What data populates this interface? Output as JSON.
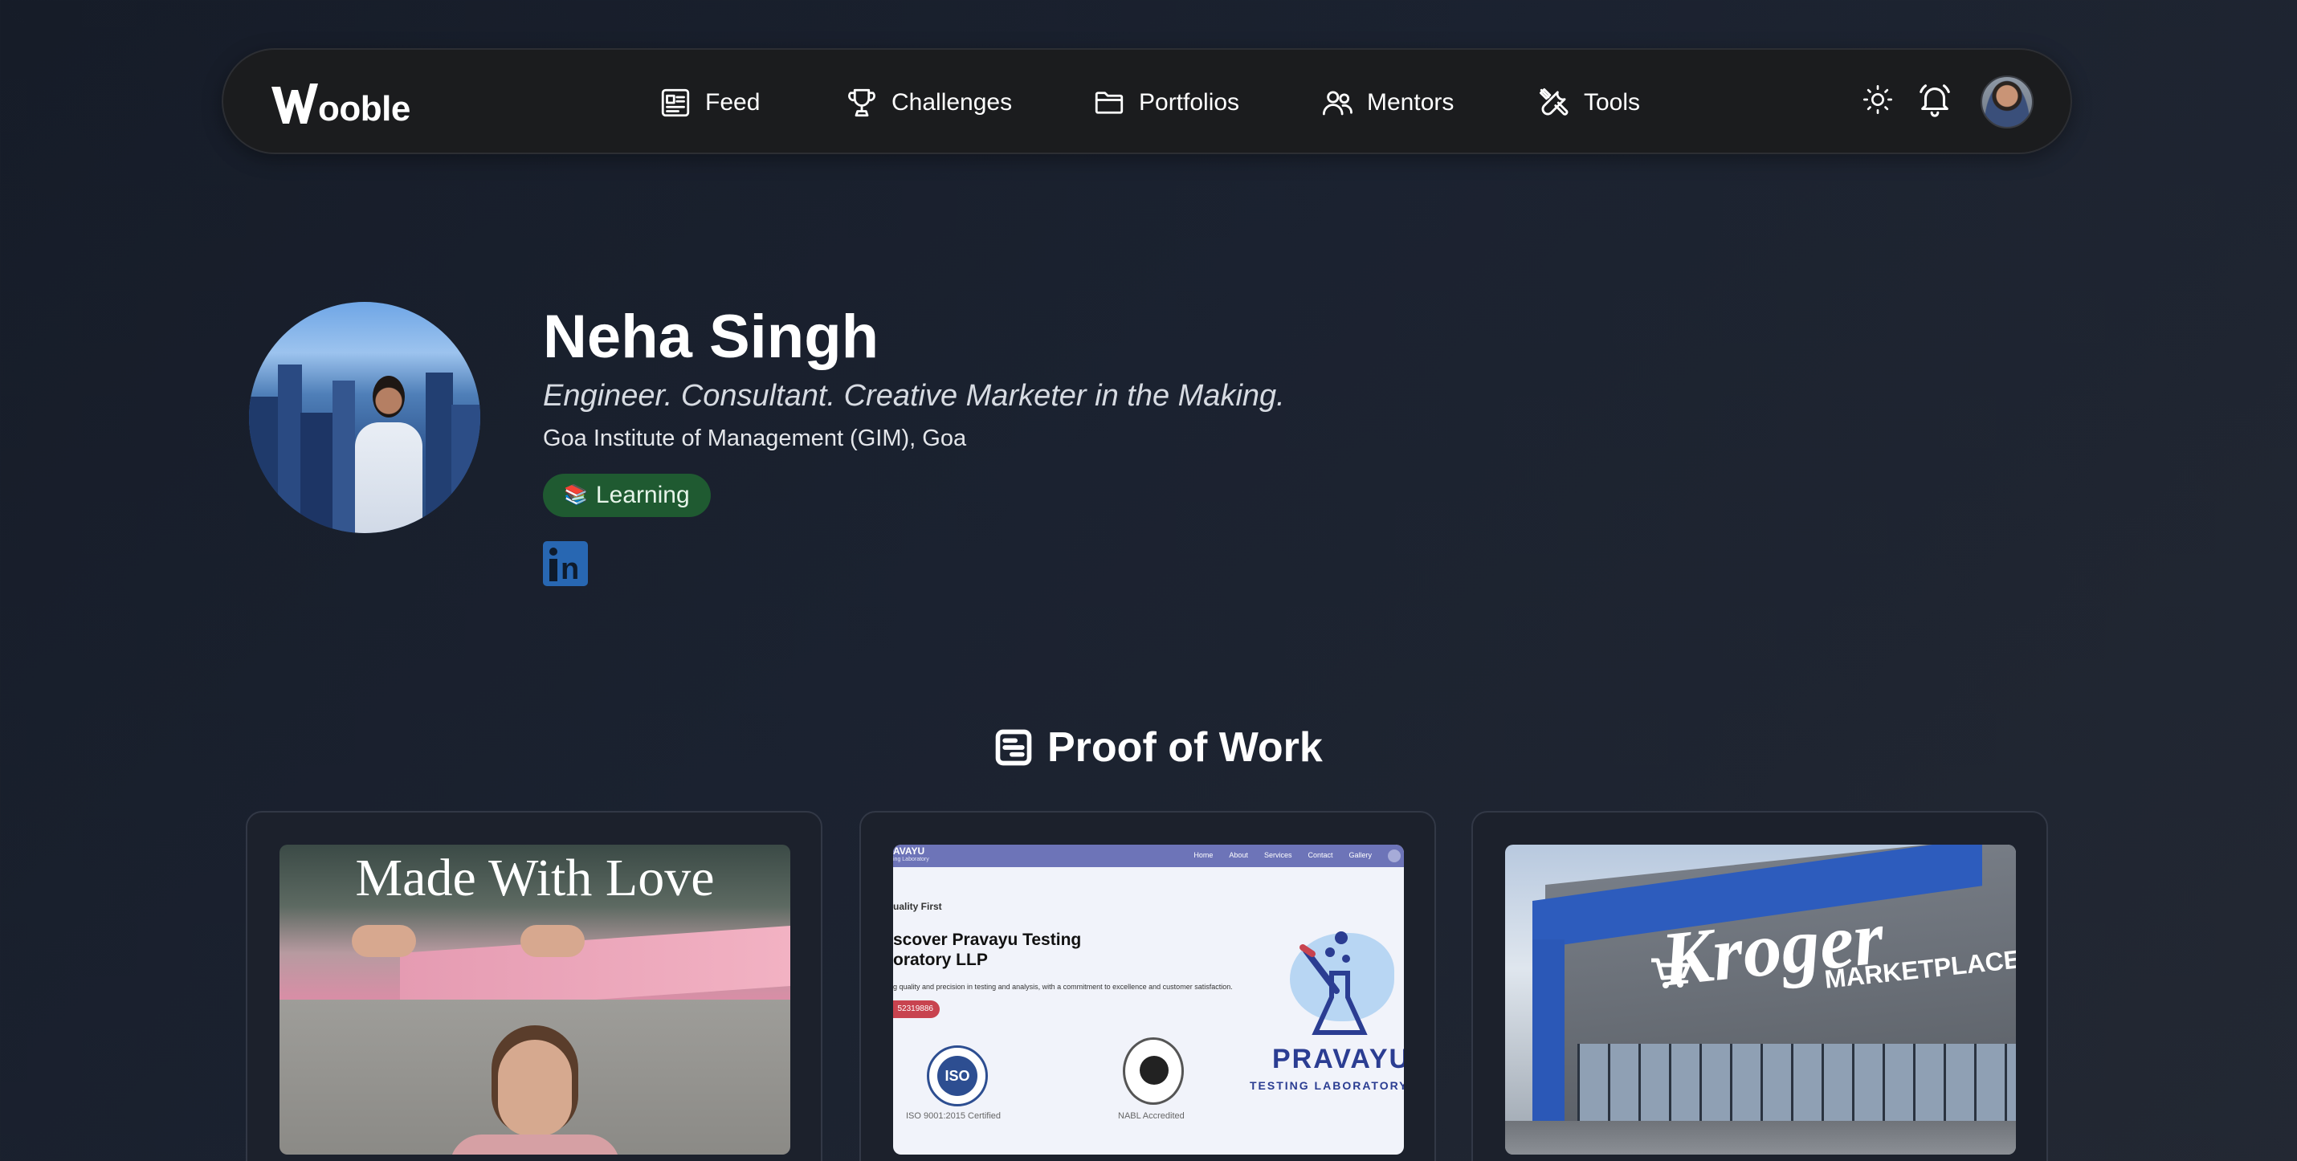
{
  "nav": {
    "logo_text": "ooble",
    "items": [
      {
        "label": "Feed",
        "icon": "newspaper-icon"
      },
      {
        "label": "Challenges",
        "icon": "trophy-icon"
      },
      {
        "label": "Portfolios",
        "icon": "folder-icon"
      },
      {
        "label": "Mentors",
        "icon": "users-icon"
      },
      {
        "label": "Tools",
        "icon": "tools-icon"
      }
    ],
    "right_icons": [
      "sun-icon",
      "bell-icon",
      "avatar"
    ]
  },
  "profile": {
    "name": "Neha Singh",
    "tagline": "Engineer. Consultant. Creative Marketer in the Making.",
    "institute": "Goa Institute of Management (GIM), Goa",
    "badge": {
      "emoji": "📚",
      "label": "Learning",
      "color": "#1f5a31"
    },
    "social": [
      "linkedin-icon"
    ]
  },
  "section": {
    "title": "Proof of Work",
    "icon": "document-list-icon"
  },
  "cards": [
    {
      "headline": "Made With Love"
    },
    {
      "brand": "AVAYU",
      "brand_sub": "ing Laboratory",
      "nav_links": [
        "Home",
        "About",
        "Services",
        "Contact",
        "Gallery"
      ],
      "quality": "uality First",
      "heading": "scover Pravayu Testing oratory LLP",
      "paragraph": "g quality and precision in testing and analysis, with a commitment to excellence and customer satisfaction.",
      "phone": "52319886",
      "iso_text": "ISO",
      "iso_label": "ISO 9001:2015 Certified",
      "nabl_label": "NABL Accredited",
      "big_brand": "PRAVAYU",
      "big_brand_sub": "TESTING LABORATORY L"
    },
    {
      "sign": "Kroger",
      "sign_sub": "MARKETPLACE"
    }
  ],
  "colors": {
    "background": "#1b2230",
    "navbar": "#1b1c1e",
    "badge_green": "#1f5a31",
    "linkedin_blue": "#2867b2"
  }
}
